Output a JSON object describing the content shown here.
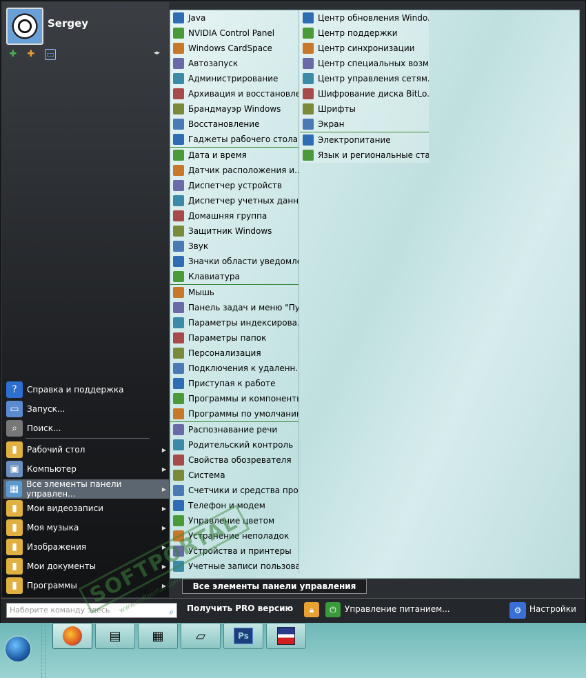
{
  "user": {
    "name": "Sergey"
  },
  "left_menu": {
    "items": [
      {
        "label": "Справка и поддержка",
        "icon": "help-icon",
        "arrow": false
      },
      {
        "label": "Запуск...",
        "icon": "run-icon",
        "arrow": false
      },
      {
        "label": "Поиск...",
        "icon": "search-icon",
        "arrow": false
      },
      {
        "label": "Рабочий стол",
        "icon": "folder-icon",
        "arrow": true
      },
      {
        "label": "Компьютер",
        "icon": "computer-icon",
        "arrow": true
      },
      {
        "label": "Все элементы панели управлен...",
        "icon": "control-panel-icon",
        "arrow": true,
        "selected": true
      },
      {
        "label": "Мои видеозаписи",
        "icon": "folder-icon",
        "arrow": true
      },
      {
        "label": "Моя музыка",
        "icon": "folder-icon",
        "arrow": true
      },
      {
        "label": "Изображения",
        "icon": "folder-icon",
        "arrow": true
      },
      {
        "label": "Мои документы",
        "icon": "folder-icon",
        "arrow": true
      },
      {
        "label": "Программы",
        "icon": "folder-icon",
        "arrow": true
      }
    ]
  },
  "control_panel": {
    "column1": [
      [
        {
          "label": "Java",
          "icon": "java-icon"
        },
        {
          "label": "NVIDIA Control Panel",
          "icon": "nvidia-icon"
        },
        {
          "label": "Windows CardSpace",
          "icon": "cardspace-icon"
        },
        {
          "label": "Автозапуск",
          "icon": "autoplay-icon"
        },
        {
          "label": "Администрирование",
          "icon": "admin-tools-icon"
        },
        {
          "label": "Архивация и восстановле...",
          "icon": "backup-icon"
        },
        {
          "label": "Брандмауэр Windows",
          "icon": "firewall-icon"
        },
        {
          "label": "Восстановление",
          "icon": "recovery-icon"
        },
        {
          "label": "Гаджеты рабочего стола",
          "icon": "gadgets-icon"
        }
      ],
      [
        {
          "label": "Дата и время",
          "icon": "clock-icon"
        },
        {
          "label": "Датчик расположения и...",
          "icon": "location-sensor-icon"
        },
        {
          "label": "Диспетчер устройств",
          "icon": "device-manager-icon"
        },
        {
          "label": "Диспетчер учетных данных",
          "icon": "credential-manager-icon"
        },
        {
          "label": "Домашняя группа",
          "icon": "homegroup-icon"
        },
        {
          "label": "Защитник Windows",
          "icon": "defender-icon"
        },
        {
          "label": "Звук",
          "icon": "sound-icon"
        },
        {
          "label": "Значки области уведомле...",
          "icon": "notification-icons-icon"
        },
        {
          "label": "Клавиатура",
          "icon": "keyboard-icon"
        }
      ],
      [
        {
          "label": "Мышь",
          "icon": "mouse-icon"
        },
        {
          "label": "Панель задач и меню \"Пу...",
          "icon": "taskbar-icon"
        },
        {
          "label": "Параметры индексирова...",
          "icon": "indexing-icon"
        },
        {
          "label": "Параметры папок",
          "icon": "folder-options-icon"
        },
        {
          "label": "Персонализация",
          "icon": "personalization-icon"
        },
        {
          "label": "Подключения к удаленн...",
          "icon": "remote-connections-icon"
        },
        {
          "label": "Приступая к работе",
          "icon": "getting-started-icon"
        },
        {
          "label": "Программы и компоненты",
          "icon": "programs-features-icon"
        },
        {
          "label": "Программы по умолчанию",
          "icon": "default-programs-icon"
        }
      ],
      [
        {
          "label": "Распознавание речи",
          "icon": "speech-recognition-icon"
        },
        {
          "label": "Родительский контроль",
          "icon": "parental-controls-icon"
        },
        {
          "label": "Свойства обозревателя",
          "icon": "internet-options-icon"
        },
        {
          "label": "Система",
          "icon": "system-icon"
        },
        {
          "label": "Счетчики и средства про...",
          "icon": "performance-icon"
        },
        {
          "label": "Телефон и модем",
          "icon": "phone-modem-icon"
        },
        {
          "label": "Управление цветом",
          "icon": "color-management-icon"
        },
        {
          "label": "Устранение неполадок",
          "icon": "troubleshooting-icon"
        },
        {
          "label": "Устройства и принтеры",
          "icon": "devices-printers-icon"
        },
        {
          "label": "Учетные записи пользова...",
          "icon": "user-accounts-icon"
        }
      ]
    ],
    "column2": [
      [
        {
          "label": "Центр обновления Windo...",
          "icon": "windows-update-icon"
        },
        {
          "label": "Центр поддержки",
          "icon": "action-center-icon"
        },
        {
          "label": "Центр синхронизации",
          "icon": "sync-center-icon"
        },
        {
          "label": "Центр специальных возм...",
          "icon": "ease-of-access-icon"
        },
        {
          "label": "Центр управления сетям...",
          "icon": "network-center-icon"
        },
        {
          "label": "Шифрование диска BitLo...",
          "icon": "bitlocker-icon"
        },
        {
          "label": "Шрифты",
          "icon": "fonts-icon"
        },
        {
          "label": "Экран",
          "icon": "display-icon"
        }
      ],
      [
        {
          "label": "Электропитание",
          "icon": "power-options-icon"
        },
        {
          "label": "Язык и региональные ста...",
          "icon": "region-language-icon"
        }
      ]
    ]
  },
  "breadcrumb": "Все элементы панели управления",
  "bottom": {
    "command_placeholder": "Наберите команду здесь",
    "pro_label": "Получить PRO версию",
    "power_label": "Управление питанием...",
    "settings_label": "Настройки"
  },
  "taskbar": {
    "buttons": [
      {
        "icon": "firefox-icon",
        "active": true
      },
      {
        "icon": "console-icon",
        "active": false
      },
      {
        "icon": "calculator-icon",
        "active": false
      },
      {
        "icon": "notepad-icon",
        "active": false
      },
      {
        "icon": "photoshop-icon",
        "active": false
      },
      {
        "icon": "floppy-save-icon",
        "active": false
      }
    ],
    "photoshop_label": "Ps"
  },
  "watermark": {
    "text": "SOFTPORTAL",
    "sub": "www.softportal.com"
  }
}
